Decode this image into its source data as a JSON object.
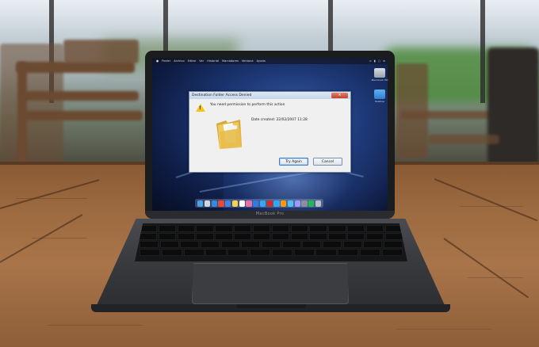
{
  "menubar": {
    "items": [
      "Finder",
      "Archivo",
      "Editar",
      "Ver",
      "Historial",
      "Marcadores",
      "Ventana",
      "Ayuda"
    ]
  },
  "dialog": {
    "title": "Destination Folder Access Denied",
    "message": "You need permission to perform this action",
    "date_created": "Date created: 22/02/2007 11:28",
    "try_again_label": "Try Again",
    "cancel_label": "Cancel",
    "close_glyph": "×"
  },
  "laptop": {
    "model_label": "MacBook Pro"
  },
  "desktop_icons": [
    {
      "name": "drive-icon",
      "label": "Macintosh HD"
    },
    {
      "name": "folder-icon",
      "label": "Desktop"
    }
  ],
  "dock": {
    "icons": [
      "finder-icon",
      "launchpad-icon",
      "safari-icon",
      "chrome-icon",
      "mail-icon",
      "notes-icon",
      "calendar-icon",
      "photos-icon",
      "appstore-icon",
      "lightroom-icon",
      "acrobat-icon",
      "photoshop-icon",
      "illustrator-icon",
      "lightroom-classic-icon",
      "aftereffects-icon",
      "preferences-icon",
      "spotify-icon",
      "trash-icon"
    ],
    "colors": [
      "#4aa3e8",
      "#cfd6e0",
      "#2e8be6",
      "#e9473a",
      "#3b86e6",
      "#f2d34a",
      "#ffffff",
      "#e86fa5",
      "#2b7be8",
      "#31a8ff",
      "#d62a22",
      "#31a8ff",
      "#ff9a00",
      "#4ac0ff",
      "#9999ff",
      "#8a8f99",
      "#1db954",
      "#b8bec8"
    ]
  },
  "colors": {
    "dialog_bg": "#f0f0f0",
    "title_bar": "#c5d6ea",
    "close_button": "#c4402a",
    "warning": "#f5c518",
    "folder": "#e8c15a"
  }
}
